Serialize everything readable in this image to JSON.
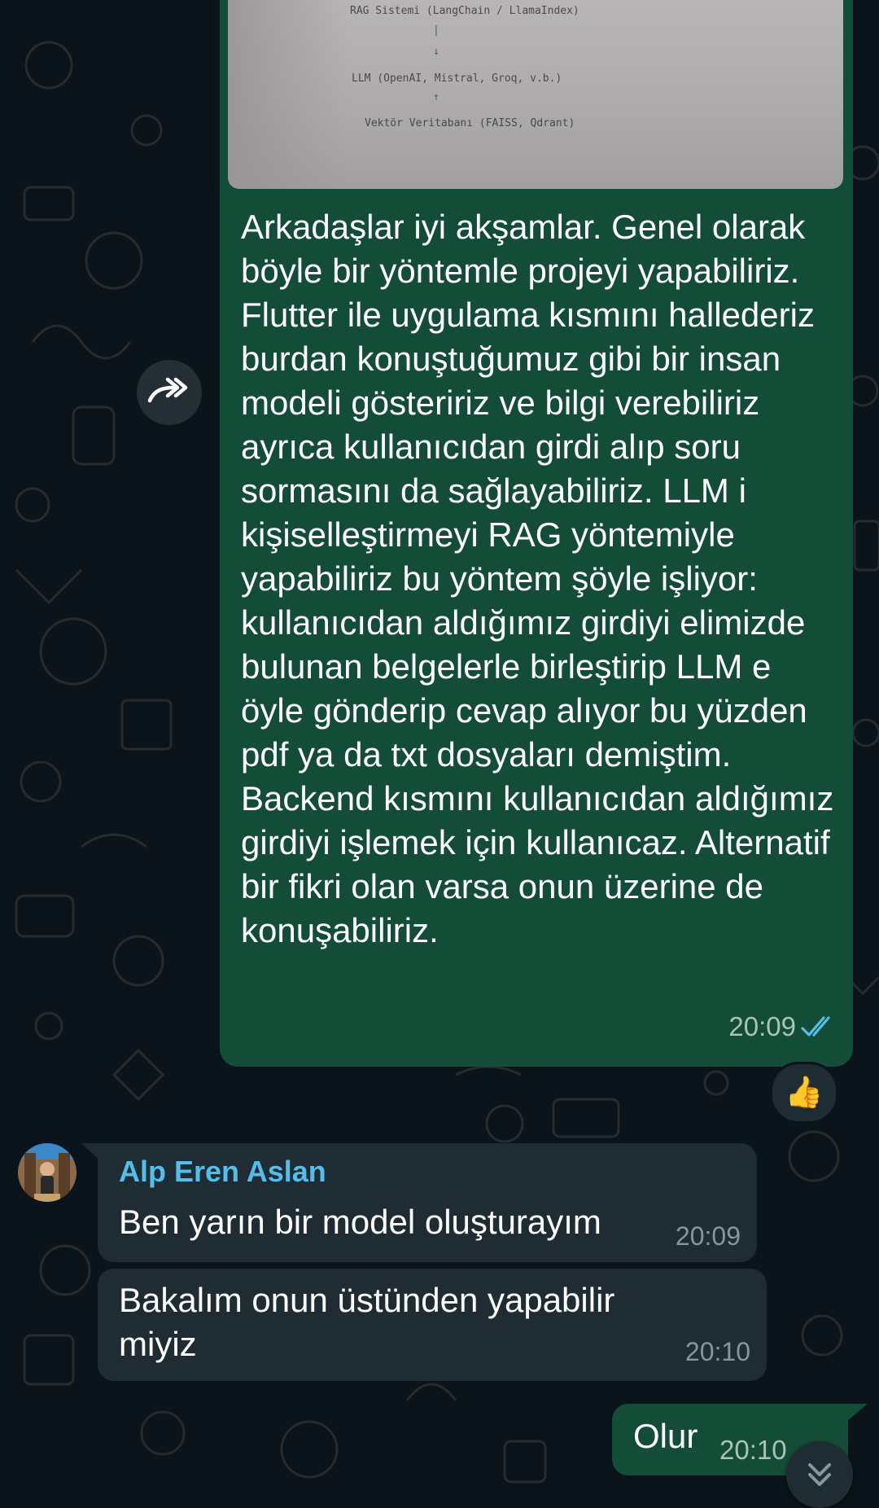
{
  "colors": {
    "background": "#0b141a",
    "outgoing_bubble": "#144d37",
    "incoming_bubble": "#1f2c34",
    "sender_name": "#53bdeb",
    "read_ticks": "#53bdeb"
  },
  "image_preview": {
    "line_1": "RAG Sistemi (LangChain / LlamaIndex)",
    "arrow_1a": "|",
    "arrow_1b": "↓",
    "line_2": "LLM (OpenAI, Mistral, Groq, v.b.)",
    "arrow_2": "↑",
    "line_3": "Vektör Veritabanı (FAISS, Qdrant)"
  },
  "messages": [
    {
      "direction": "outgoing",
      "text": "Arkadaşlar iyi akşamlar. Genel olarak böyle bir yöntemle projeyi yapabiliriz. Flutter ile uygulama kısmını hallederiz burdan konuştuğumuz gibi bir insan modeli gösteririz ve bilgi verebiliriz ayrıca kullanıcıdan girdi alıp soru sormasını da sağlayabiliriz. LLM i kişiselleştirmeyi RAG yöntemiyle yapabiliriz bu yöntem şöyle işliyor: kullanıcıdan aldığımız girdiyi elimizde bulunan belgelerle birleştirip LLM e öyle gönderip cevap alıyor bu yüzden pdf ya da txt dosyaları demiştim. Backend kısmını kullanıcıdan aldığımız girdiyi işlemek için kullanıcaz. Alternatif bir fikri olan varsa onun üzerine de konuşabiliriz.",
      "time": "20:09",
      "status_icon": "double-check-read-icon",
      "reaction": "👍"
    },
    {
      "direction": "incoming",
      "sender": "Alp Eren Aslan",
      "text": "Ben yarın bir model oluşturayım",
      "time": "20:09"
    },
    {
      "direction": "incoming",
      "text": "Bakalım onun üstünden yapabilir miyiz",
      "time": "20:10"
    },
    {
      "direction": "outgoing",
      "text": "Olur",
      "time": "20:10"
    }
  ],
  "icons": {
    "forward": "forward-icon",
    "scroll_down": "chevrons-down-icon"
  }
}
